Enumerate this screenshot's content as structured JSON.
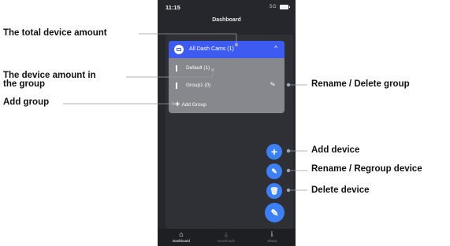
{
  "status_bar": {
    "time": "11:15",
    "signal": "5G"
  },
  "app": {
    "title": "Dashboard"
  },
  "group_card": {
    "header_label": "All Dash Cams (1)",
    "chevron": "^",
    "groups": [
      {
        "label": "Default (1)"
      },
      {
        "label": "Group1 (0)"
      }
    ],
    "add_group_label": "Add Group"
  },
  "fab": {
    "add": "+",
    "rename": "✎",
    "delete": "🗑",
    "edit": "✎"
  },
  "bottom_nav": [
    {
      "label": "Dashboard",
      "icon": "home-icon"
    },
    {
      "label": "Downloads",
      "icon": "download-icon"
    },
    {
      "label": "About",
      "icon": "info-icon"
    }
  ],
  "annotations": {
    "total_device_amount": "The total device amount",
    "device_amount_in_group_line1": "The device amount in",
    "device_amount_in_group_line2": "the group",
    "add_group": "Add group",
    "rename_delete_group": "Rename / Delete group",
    "add_device": "Add device",
    "rename_regroup_device": "Rename / Regroup device",
    "delete_device": "Delete device"
  },
  "colors": {
    "accent": "#3d5af1",
    "fab": "#3d7ff5",
    "background": "#26272c",
    "card": "#86888e"
  }
}
